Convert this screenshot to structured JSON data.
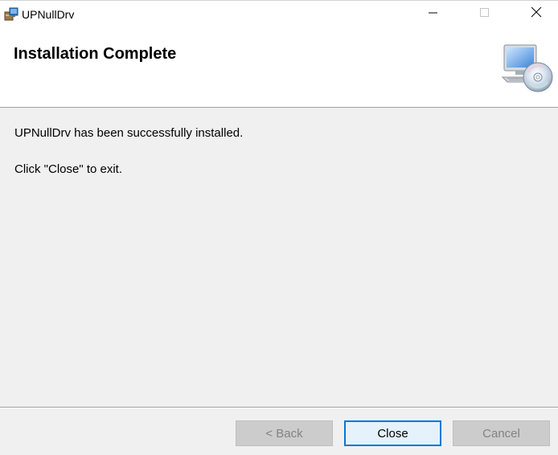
{
  "window": {
    "title": "UPNullDrv",
    "icons": {
      "app": "installer-package-icon",
      "minimize": "minimize-icon",
      "maximize": "maximize-icon",
      "close": "close-icon"
    }
  },
  "banner": {
    "title": "Installation Complete",
    "icon": "computer-disc-icon"
  },
  "content": {
    "message": "UPNullDrv has been successfully installed.",
    "instruction": "Click \"Close\" to exit."
  },
  "buttons": {
    "back": {
      "label": "< Back",
      "enabled": false
    },
    "close": {
      "label": "Close",
      "enabled": true,
      "focused": true
    },
    "cancel": {
      "label": "Cancel",
      "enabled": false
    }
  },
  "colors": {
    "accent": "#0078d7",
    "dialog_background": "#f0f0f0",
    "banner_background": "#ffffff",
    "disabled_text": "#838383"
  }
}
